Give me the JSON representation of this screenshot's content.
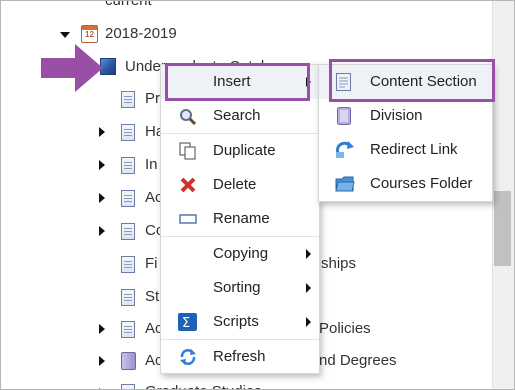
{
  "tree": {
    "top_partial": "current",
    "year_node": {
      "label": "2018-2019",
      "icon": "calendar-icon",
      "calendar_number": "12"
    },
    "selected_node_partial": "Undergraduate Catalog",
    "rows": [
      {
        "label": "Pr",
        "expandable": false,
        "icon": "document-icon"
      },
      {
        "label": "Ha",
        "expandable": true,
        "icon": "document-icon"
      },
      {
        "label": "In",
        "expandable": true,
        "icon": "document-icon"
      },
      {
        "label": "Ac",
        "expandable": true,
        "icon": "document-icon"
      },
      {
        "label": "Co",
        "expandable": true,
        "icon": "document-icon"
      },
      {
        "label": "Fi",
        "expandable": false,
        "icon": "document-icon",
        "tail": "ships"
      },
      {
        "label": "St",
        "expandable": false,
        "icon": "document-icon"
      },
      {
        "label": "Ac",
        "expandable": true,
        "icon": "document-icon",
        "tail": "Policies"
      },
      {
        "label": "Ac",
        "expandable": true,
        "icon": "division-icon",
        "tail": "nd Degrees"
      },
      {
        "label": "Graduate Studies",
        "expandable": true,
        "icon": "document-icon"
      }
    ]
  },
  "context_menu": {
    "items": [
      {
        "label": "Insert",
        "icon": "",
        "submenu": true
      },
      {
        "label": "Search",
        "icon": "search-icon",
        "submenu": false
      },
      {
        "label": "Duplicate",
        "icon": "duplicate-icon",
        "submenu": false
      },
      {
        "label": "Delete",
        "icon": "delete-icon",
        "submenu": false
      },
      {
        "label": "Rename",
        "icon": "rename-icon",
        "submenu": false
      },
      {
        "label": "Copying",
        "icon": "",
        "submenu": true
      },
      {
        "label": "Sorting",
        "icon": "",
        "submenu": true
      },
      {
        "label": "Scripts",
        "icon": "scripts-icon",
        "submenu": true
      },
      {
        "label": "Refresh",
        "icon": "refresh-icon",
        "submenu": false
      }
    ]
  },
  "insert_submenu": {
    "items": [
      {
        "label": "Content Section",
        "icon": "content-section-icon"
      },
      {
        "label": "Division",
        "icon": "division-icon"
      },
      {
        "label": "Redirect Link",
        "icon": "redirect-link-icon"
      },
      {
        "label": "Courses Folder",
        "icon": "courses-folder-icon"
      }
    ]
  },
  "annotations": {
    "pointer_arrow_color": "#9a4fa6",
    "highlight_color": "#9a4fa6"
  }
}
